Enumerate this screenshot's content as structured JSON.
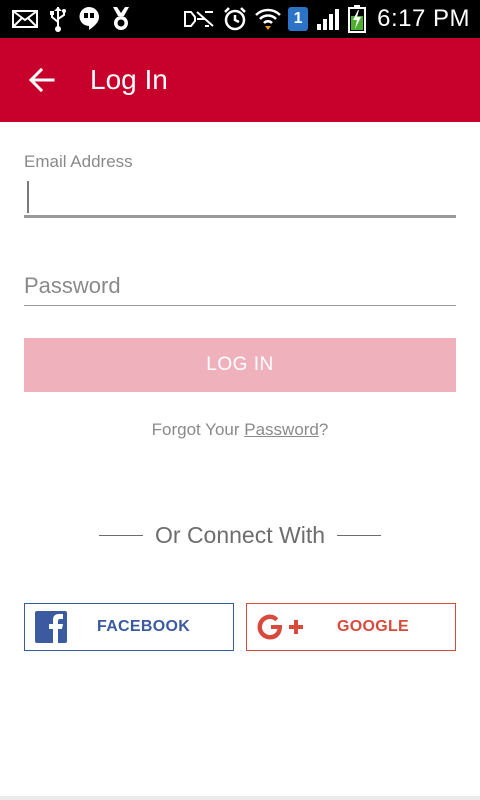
{
  "status_bar": {
    "time": "6:17 PM",
    "sim_number": "1",
    "icons": [
      "mail-icon",
      "usb-icon",
      "hangouts-icon",
      "award-icon",
      "mute-icon",
      "alarm-icon",
      "wifi-icon",
      "sim-icon",
      "signal-icon",
      "battery-icon"
    ]
  },
  "app_bar": {
    "title": "Log In",
    "back_icon": "arrow-left-icon",
    "color": "#c8002c"
  },
  "form": {
    "email_label": "Email Address",
    "email_value": "",
    "password_placeholder": "Password",
    "login_label": "LOG IN",
    "login_color": "#efb2bd"
  },
  "forgot": {
    "prefix": "Forgot Your ",
    "link": "Password",
    "suffix": "?"
  },
  "connect": {
    "text": "Or Connect With"
  },
  "social": {
    "facebook_label": "FACEBOOK",
    "facebook_color": "#3b5aa0",
    "google_label": "GOOGLE",
    "google_color": "#d84a3c"
  }
}
